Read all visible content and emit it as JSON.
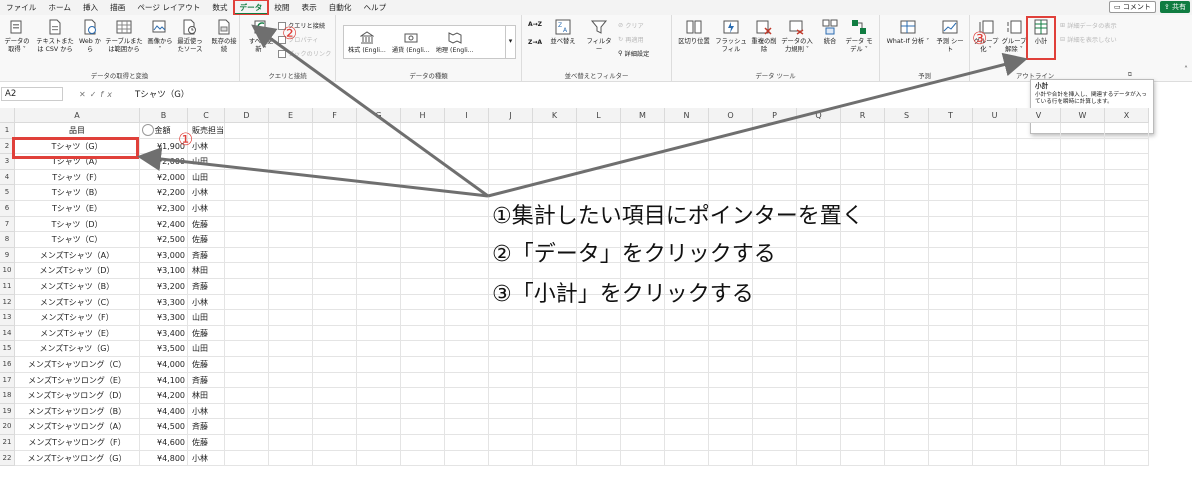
{
  "tabs": [
    "ファイル",
    "ホーム",
    "挿入",
    "描画",
    "ページ レイアウト",
    "数式",
    "データ",
    "校閲",
    "表示",
    "自動化",
    "ヘルプ"
  ],
  "active_tab": "データ",
  "right_buttons": {
    "comment": "コメント",
    "share": "共有"
  },
  "ribbon": {
    "get_transform": {
      "label": "データの取得と変換",
      "buttons": [
        "データの取得 ˅",
        "テキストまたは CSV から",
        "Web から",
        "テーブルまたは範囲から",
        "画像から ˅",
        "最近使ったソース",
        "既存の接続"
      ]
    },
    "queries": {
      "label": "クエリと接続",
      "refresh": "すべて更新 ˅",
      "items": [
        "クエリと接続",
        "プロパティ",
        "ブックのリンク"
      ]
    },
    "data_types": {
      "label": "データの種類",
      "items": [
        "株式 (Engli...",
        "通貨 (Engli...",
        "地理 (Engli..."
      ]
    },
    "sort_filter": {
      "label": "並べ替えとフィルター",
      "az": "A→Z",
      "za": "Z→A",
      "sort": "並べ替え",
      "filter": "フィルター",
      "clear": "クリア",
      "reapply": "再適用",
      "advanced": "詳細設定"
    },
    "data_tools": {
      "label": "データ ツール",
      "buttons": [
        "区切り位置",
        "フラッシュ フィル",
        "重複の削除",
        "データの入力規則 ˅",
        "統合",
        "データ モデル ˅"
      ]
    },
    "forecast": {
      "label": "予測",
      "buttons": [
        "What-If 分析 ˅",
        "予測 シート"
      ]
    },
    "outline": {
      "label": "アウトライン",
      "buttons": [
        "グループ化 ˅",
        "グループ解除 ˅",
        "小計"
      ],
      "show_detail": "詳細データの表示",
      "hide_detail": "詳細を表示しない"
    }
  },
  "tooltip": {
    "title": "小計",
    "body": "小計や合計を挿入し、関連するデータが入っている行を瞬時に計算します。"
  },
  "formula_bar": {
    "cell_ref": "A2",
    "content": "Tシャツ（G）"
  },
  "columns": [
    "A",
    "B",
    "C",
    "D",
    "E",
    "F",
    "G",
    "H",
    "I",
    "J",
    "K",
    "L",
    "M",
    "N",
    "O",
    "P",
    "Q",
    "R",
    "S",
    "T",
    "U",
    "V",
    "W",
    "X"
  ],
  "rows": [
    [
      "品目",
      "金額",
      "販売担当"
    ],
    [
      "Tシャツ（G）",
      "¥1,900",
      "小林"
    ],
    [
      "Tシャツ（A）",
      "¥2,000",
      "山田"
    ],
    [
      "Tシャツ（F）",
      "¥2,000",
      "山田"
    ],
    [
      "Tシャツ（B）",
      "¥2,200",
      "小林"
    ],
    [
      "Tシャツ（E）",
      "¥2,300",
      "小林"
    ],
    [
      "Tシャツ（D）",
      "¥2,400",
      "佐藤"
    ],
    [
      "Tシャツ（C）",
      "¥2,500",
      "佐藤"
    ],
    [
      "メンズTシャツ（A）",
      "¥3,000",
      "斉藤"
    ],
    [
      "メンズTシャツ（D）",
      "¥3,100",
      "林田"
    ],
    [
      "メンズTシャツ（B）",
      "¥3,200",
      "斉藤"
    ],
    [
      "メンズTシャツ（C）",
      "¥3,300",
      "小林"
    ],
    [
      "メンズTシャツ（F）",
      "¥3,300",
      "山田"
    ],
    [
      "メンズTシャツ（E）",
      "¥3,400",
      "佐藤"
    ],
    [
      "メンズTシャツ（G）",
      "¥3,500",
      "山田"
    ],
    [
      "メンズTシャツロング（C）",
      "¥4,000",
      "佐藤"
    ],
    [
      "メンズTシャツロング（E）",
      "¥4,100",
      "斉藤"
    ],
    [
      "メンズTシャツロング（D）",
      "¥4,200",
      "林田"
    ],
    [
      "メンズTシャツロング（B）",
      "¥4,400",
      "小林"
    ],
    [
      "メンズTシャツロング（A）",
      "¥4,500",
      "斉藤"
    ],
    [
      "メンズTシャツロング（F）",
      "¥4,600",
      "佐藤"
    ],
    [
      "メンズTシャツロング（G）",
      "¥4,800",
      "小林"
    ]
  ],
  "annotations": {
    "badge1": "①",
    "badge2": "②",
    "badge3": "③",
    "steps": [
      "①集計したい項目にポインターを置く",
      "②「データ」をクリックする",
      "③「小計」をクリックする"
    ]
  },
  "colors": {
    "accent": "#107c41",
    "annotation": "#e0403a",
    "arrow": "#6f6f6f"
  }
}
